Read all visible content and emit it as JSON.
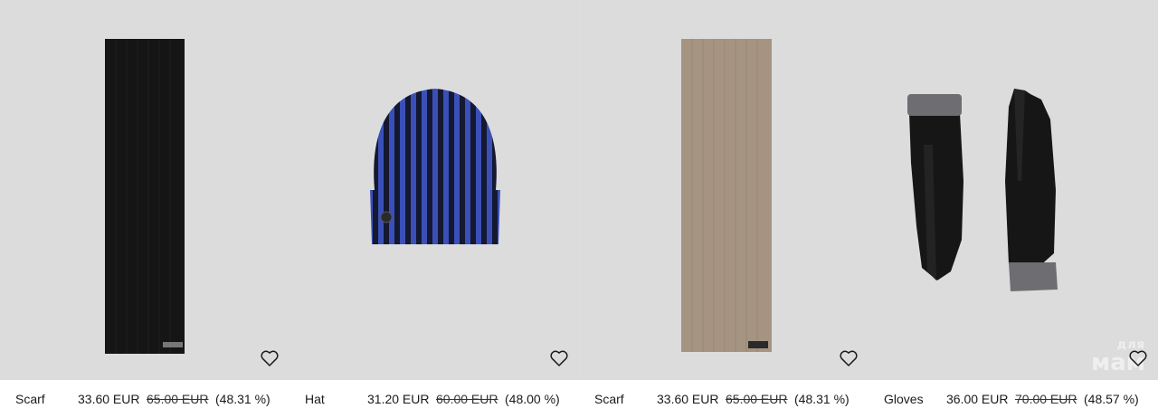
{
  "products": [
    {
      "name": "Scarf",
      "price": "33.60 EUR",
      "old_price": "65.00 EUR",
      "discount": "(48.31 %)",
      "wishlist_icon": "heart-outline-icon"
    },
    {
      "name": "Hat",
      "price": "31.20 EUR",
      "old_price": "60.00 EUR",
      "discount": "(48.00 %)",
      "wishlist_icon": "heart-outline-icon"
    },
    {
      "name": "Scarf",
      "price": "33.60 EUR",
      "old_price": "65.00 EUR",
      "discount": "(48.31 %)",
      "wishlist_icon": "heart-outline-icon"
    },
    {
      "name": "Gloves",
      "price": "36.00 EUR",
      "old_price": "70.00 EUR",
      "discount": "(48.57 %)",
      "wishlist_icon": "heart-outline-icon"
    }
  ],
  "watermark": {
    "line1": "для",
    "line2": "мам"
  },
  "colors": {
    "background": "#dcdcdc",
    "scarf_black": "#151515",
    "hat_blue": "#3448a6",
    "scarf_taupe": "#a69482",
    "gloves_black": "#161616"
  }
}
